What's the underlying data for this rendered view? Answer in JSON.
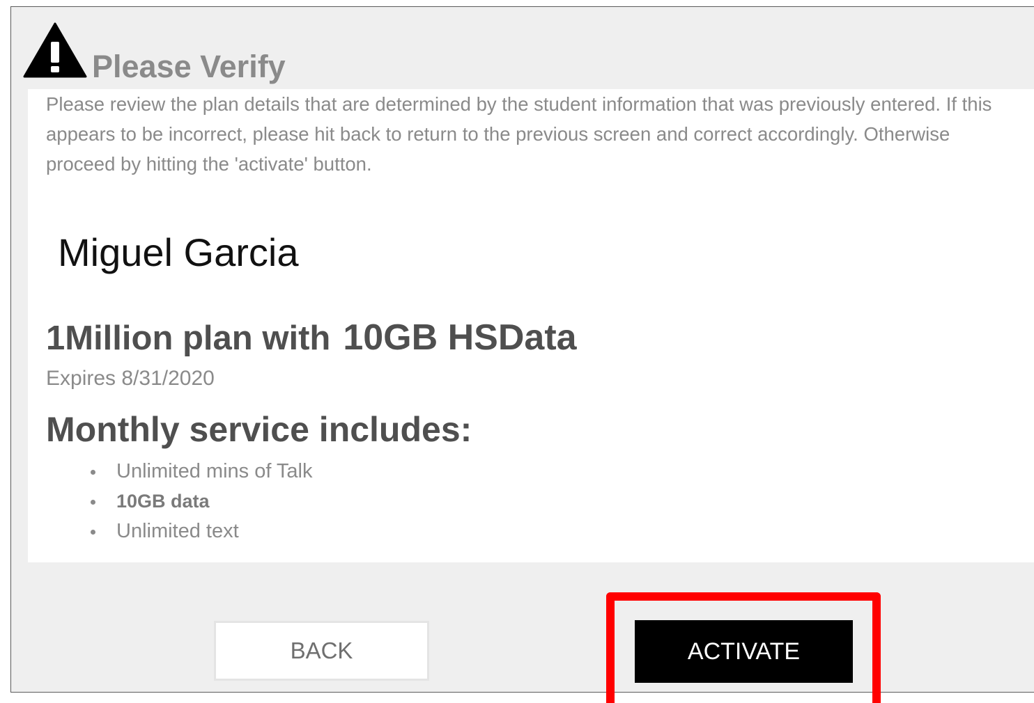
{
  "dialog": {
    "title": "Please Verify",
    "intro": "Please review the plan details that are determined by the student information that was previously entered. If this appears to be incorrect, please hit back to return to the previous screen and correct accordingly. Otherwise proceed by hitting the 'activate' button."
  },
  "student": {
    "name": "Miguel Garcia"
  },
  "plan": {
    "name": "1Million plan with",
    "data": "10GB HSData",
    "expires": "Expires 8/31/2020"
  },
  "includes": {
    "heading": "Monthly service includes:",
    "items": [
      {
        "label": "Unlimited mins of Talk"
      },
      {
        "label": "10GB data"
      },
      {
        "label": "Unlimited text"
      }
    ]
  },
  "actions": {
    "back_label": "BACK",
    "activate_label": "ACTIVATE"
  },
  "colors": {
    "highlight": "#ff0000",
    "activate_bg": "#000000",
    "muted_text": "#8a8a8a",
    "heading_text": "#4f4f4f"
  }
}
